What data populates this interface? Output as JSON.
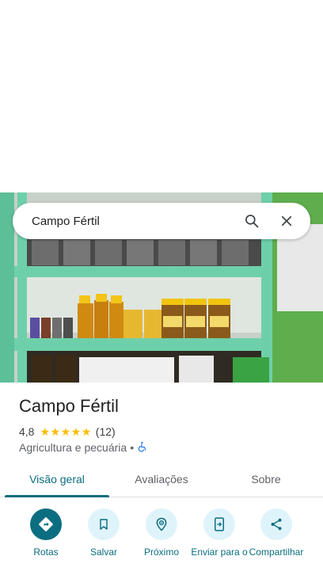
{
  "search": {
    "query": "Campo Fértil"
  },
  "place": {
    "name": "Campo Fértil",
    "rating": "4,8",
    "stars": 5,
    "review_count": "(12)",
    "category": "Agricultura e pecuária",
    "separator": "•"
  },
  "tabs": [
    {
      "label": "Visão geral",
      "active": true
    },
    {
      "label": "Avaliações",
      "active": false
    },
    {
      "label": "Sobre",
      "active": false
    }
  ],
  "actions": [
    {
      "label": "Rotas",
      "icon": "directions-icon"
    },
    {
      "label": "Salvar",
      "icon": "bookmark-icon"
    },
    {
      "label": "Próximo",
      "icon": "nearby-icon"
    },
    {
      "label": "Enviar para o",
      "icon": "send-to-phone-icon"
    },
    {
      "label": "Compartilhar",
      "icon": "share-icon"
    }
  ],
  "colors": {
    "accent": "#0b6e80",
    "chip_bg": "#dff3fb",
    "star": "#fbbc04",
    "shelf": "#6cc3a3"
  }
}
